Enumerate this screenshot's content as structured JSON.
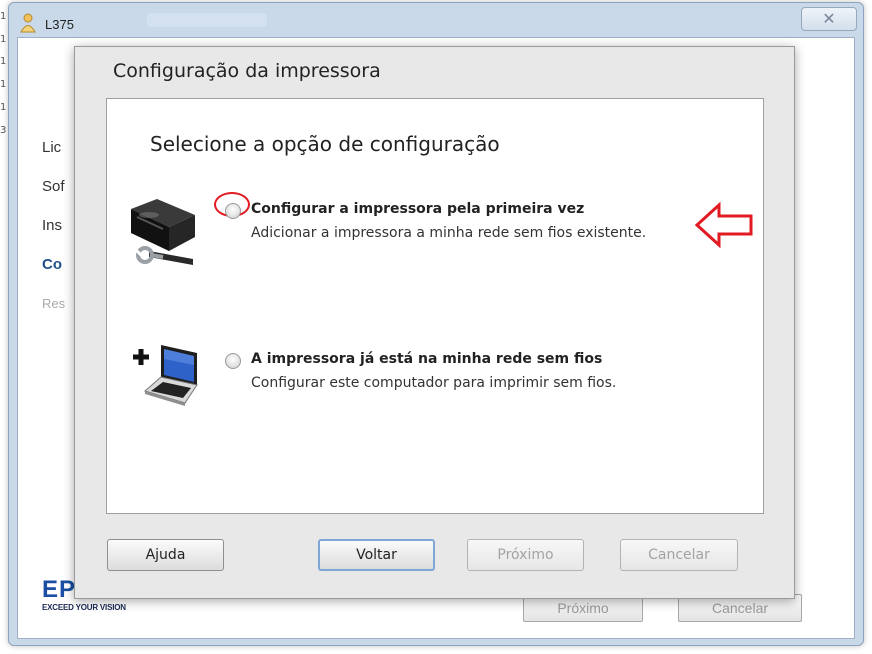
{
  "outer_window": {
    "title": "L375",
    "close_glyph": "✕",
    "nav_items": [
      "Lic",
      "Sof",
      "Ins",
      "Co",
      "Res"
    ],
    "logo_mark": "EP",
    "logo_tagline": "EXCEED YOUR VISION",
    "next_label": "Próximo",
    "cancel_label": "Cancelar"
  },
  "edge_marks": [
    "1",
    "1",
    "1",
    "1",
    "1",
    "3"
  ],
  "dialog": {
    "title": "Configuração da impressora",
    "heading": "Selecione a opção de configuração",
    "options": [
      {
        "title": "Configurar a impressora pela primeira vez",
        "description": "Adicionar a impressora a minha rede sem fios existente.",
        "icon": "printer-wrench-icon",
        "selected": false
      },
      {
        "title": "A impressora já está na minha rede sem fios",
        "description": "Configurar este computador para imprimir sem fios.",
        "icon": "plus-laptop-icon",
        "selected": false
      }
    ],
    "buttons": {
      "help": "Ajuda",
      "back": "Voltar",
      "next": "Próximo",
      "cancel": "Cancelar"
    }
  },
  "annotation": {
    "highlight_color": "#e21b23",
    "arrow_icon": "left-arrow-outline-icon"
  }
}
